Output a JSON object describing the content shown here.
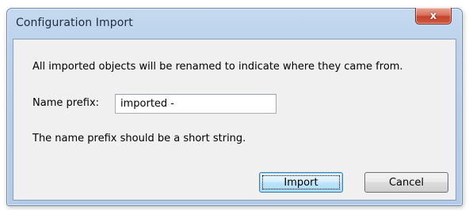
{
  "window": {
    "title": "Configuration Import",
    "close_glyph": "x"
  },
  "dialog": {
    "info_text": "All imported objects will be renamed to indicate where they came from.",
    "prefix_label": "Name prefix:",
    "prefix_value": "imported -",
    "hint_text": "The name prefix should be a short string."
  },
  "buttons": {
    "import_label": "Import",
    "cancel_label": "Cancel"
  },
  "icons": {
    "close": "close-icon"
  },
  "colors": {
    "frame": "#b6cde8",
    "close_button": "#c4432c",
    "default_button_border": "#3c7fb1",
    "client_bg": "#f0f0f0"
  }
}
